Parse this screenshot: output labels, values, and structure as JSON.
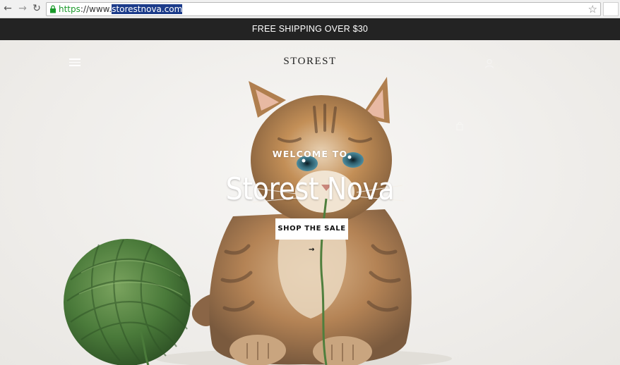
{
  "browser": {
    "url_scheme": "https",
    "url_prefix": "://www.",
    "url_selected": "storestnova.com",
    "icons": [
      "back-arrow-icon",
      "forward-arrow-icon",
      "reload-icon",
      "lock-icon",
      "star-icon"
    ]
  },
  "announcement": {
    "text": "FREE SHIPPING OVER $30"
  },
  "header": {
    "logo": "STOREST",
    "icons": [
      "hamburger-menu-icon",
      "account-icon",
      "cart-icon"
    ]
  },
  "hero": {
    "eyebrow": "WELCOME TO",
    "title": "Storest Nova",
    "cta_label": "SHOP THE SALE →",
    "image": "kitten-with-green-yarn-ball"
  },
  "colors": {
    "announcement_bg": "#232323",
    "accent_green": "#1a9a2a",
    "selection": "#1b3b8a",
    "yarn": "#4a7a3a"
  }
}
